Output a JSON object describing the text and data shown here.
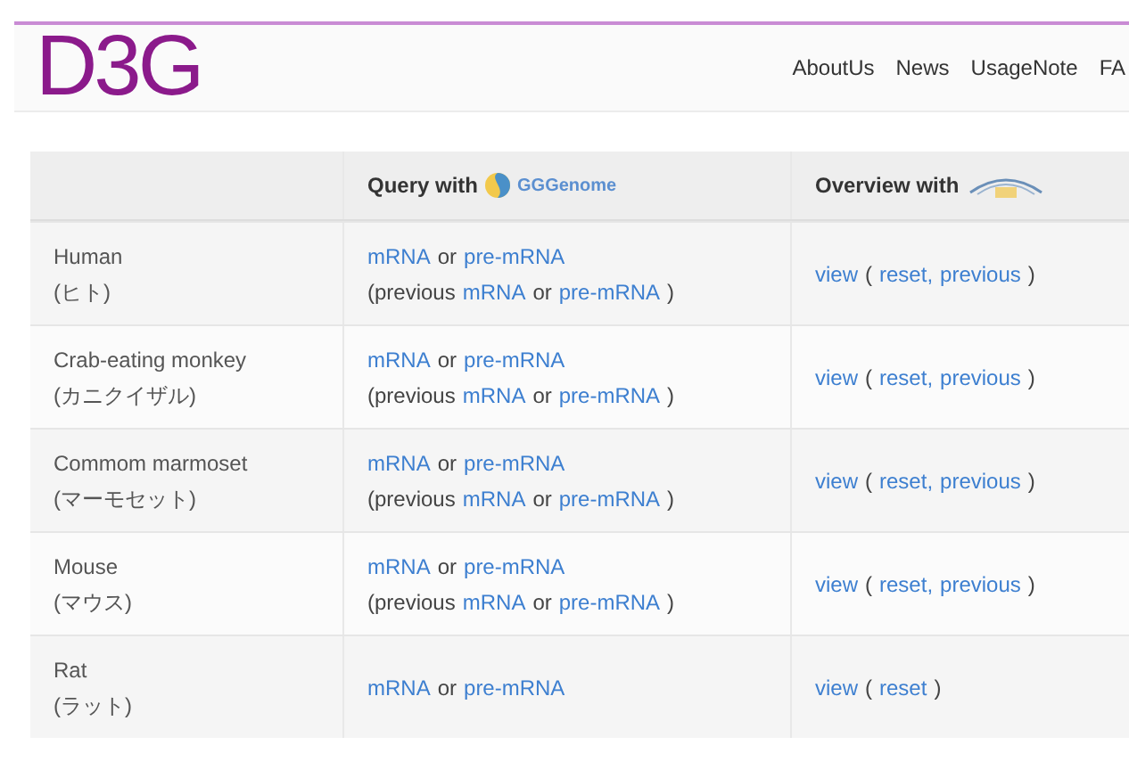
{
  "header": {
    "logo": "D3G",
    "nav": [
      "AboutUs",
      "News",
      "UsageNote",
      "FA"
    ]
  },
  "table": {
    "columns": [
      {},
      {
        "label": "Query with",
        "logo": "GGGenome"
      },
      {
        "label": "Overview with"
      }
    ],
    "rows": [
      {
        "name": "Human",
        "jp": "(ヒト)",
        "query": [
          [
            {
              "kind": "link",
              "text": "mRNA"
            },
            {
              "kind": "text",
              "text": "or"
            },
            {
              "kind": "link",
              "text": "pre-mRNA"
            }
          ],
          [
            {
              "kind": "text",
              "text": "(previous"
            },
            {
              "kind": "link",
              "text": "mRNA"
            },
            {
              "kind": "text",
              "text": "or"
            },
            {
              "kind": "link",
              "text": "pre-mRNA"
            },
            {
              "kind": "text",
              "text": ")"
            }
          ]
        ],
        "overview": [
          {
            "kind": "link",
            "text": "view"
          },
          {
            "kind": "text",
            "text": "("
          },
          {
            "kind": "link",
            "text": "reset,"
          },
          {
            "kind": "link",
            "text": "previous"
          },
          {
            "kind": "text",
            "text": ")"
          }
        ]
      },
      {
        "name": "Crab-eating monkey",
        "jp": "(カニクイザル)",
        "query": [
          [
            {
              "kind": "link",
              "text": "mRNA"
            },
            {
              "kind": "text",
              "text": "or"
            },
            {
              "kind": "link",
              "text": "pre-mRNA"
            }
          ],
          [
            {
              "kind": "text",
              "text": "(previous"
            },
            {
              "kind": "link",
              "text": "mRNA"
            },
            {
              "kind": "text",
              "text": "or"
            },
            {
              "kind": "link",
              "text": "pre-mRNA"
            },
            {
              "kind": "text",
              "text": ")"
            }
          ]
        ],
        "overview": [
          {
            "kind": "link",
            "text": "view"
          },
          {
            "kind": "text",
            "text": "("
          },
          {
            "kind": "link",
            "text": "reset,"
          },
          {
            "kind": "link",
            "text": "previous"
          },
          {
            "kind": "text",
            "text": ")"
          }
        ]
      },
      {
        "name": "Commom marmoset",
        "jp": "(マーモセット)",
        "query": [
          [
            {
              "kind": "link",
              "text": "mRNA"
            },
            {
              "kind": "text",
              "text": "or"
            },
            {
              "kind": "link",
              "text": "pre-mRNA"
            }
          ],
          [
            {
              "kind": "text",
              "text": "(previous"
            },
            {
              "kind": "link",
              "text": "mRNA"
            },
            {
              "kind": "text",
              "text": "or"
            },
            {
              "kind": "link",
              "text": "pre-mRNA"
            },
            {
              "kind": "text",
              "text": ")"
            }
          ]
        ],
        "overview": [
          {
            "kind": "link",
            "text": "view"
          },
          {
            "kind": "text",
            "text": "("
          },
          {
            "kind": "link",
            "text": "reset,"
          },
          {
            "kind": "link",
            "text": "previous"
          },
          {
            "kind": "text",
            "text": ")"
          }
        ]
      },
      {
        "name": "Mouse",
        "jp": "(マウス)",
        "query": [
          [
            {
              "kind": "link",
              "text": "mRNA"
            },
            {
              "kind": "text",
              "text": "or"
            },
            {
              "kind": "link",
              "text": "pre-mRNA"
            }
          ],
          [
            {
              "kind": "text",
              "text": "(previous"
            },
            {
              "kind": "link",
              "text": "mRNA"
            },
            {
              "kind": "text",
              "text": "or"
            },
            {
              "kind": "link",
              "text": "pre-mRNA"
            },
            {
              "kind": "text",
              "text": ")"
            }
          ]
        ],
        "overview": [
          {
            "kind": "link",
            "text": "view"
          },
          {
            "kind": "text",
            "text": "("
          },
          {
            "kind": "link",
            "text": "reset,"
          },
          {
            "kind": "link",
            "text": "previous"
          },
          {
            "kind": "text",
            "text": ")"
          }
        ]
      },
      {
        "name": "Rat",
        "jp": "(ラット)",
        "query": [
          [
            {
              "kind": "link",
              "text": "mRNA"
            },
            {
              "kind": "text",
              "text": "or"
            },
            {
              "kind": "link",
              "text": "pre-mRNA"
            }
          ]
        ],
        "overview": [
          {
            "kind": "link",
            "text": "view"
          },
          {
            "kind": "text",
            "text": "("
          },
          {
            "kind": "link",
            "text": "reset"
          },
          {
            "kind": "text",
            "text": ")"
          }
        ]
      }
    ]
  }
}
